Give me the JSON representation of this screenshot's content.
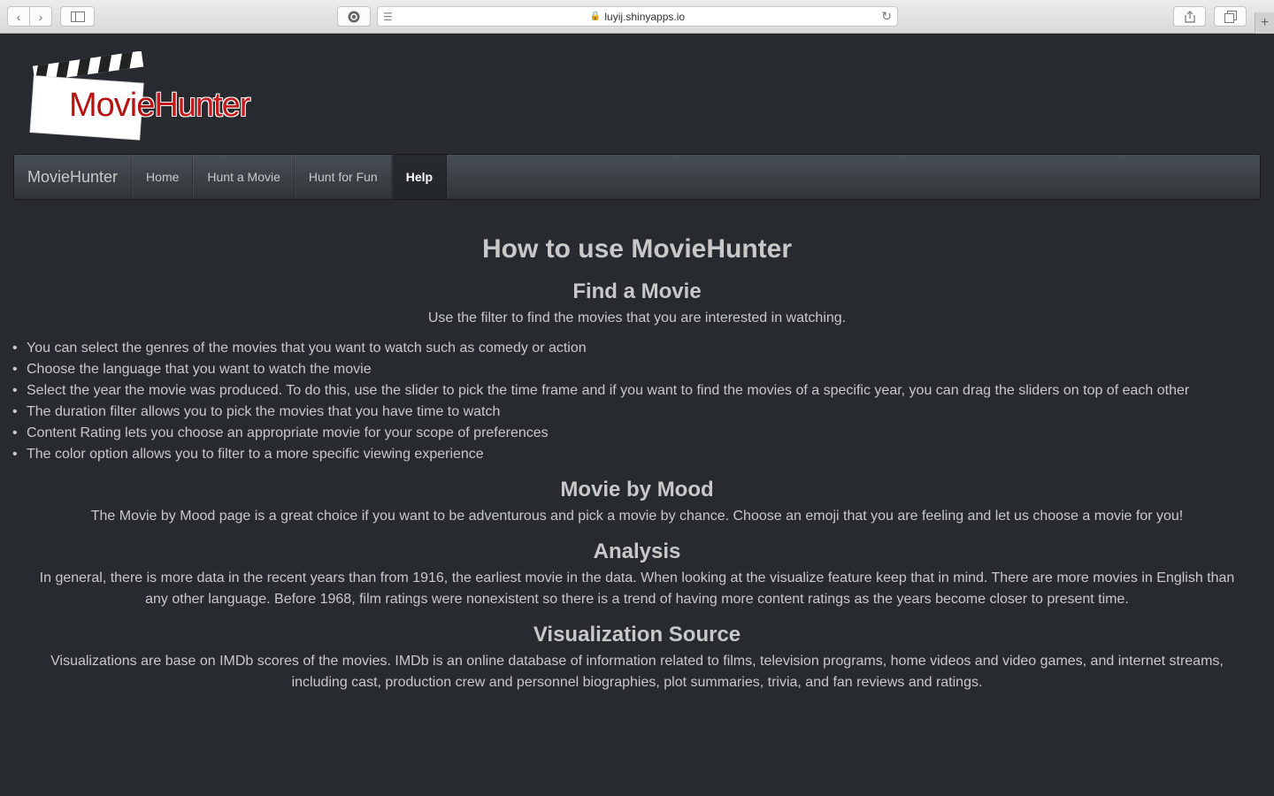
{
  "browser": {
    "url": "luyij.shinyapps.io"
  },
  "logo": {
    "text_movie": "Movie",
    "text_hunter": "Hunter"
  },
  "navbar": {
    "brand": "MovieHunter",
    "items": [
      {
        "label": "Home"
      },
      {
        "label": "Hunt a Movie"
      },
      {
        "label": "Hunt for Fun"
      },
      {
        "label": "Help"
      }
    ],
    "active": "Help"
  },
  "content": {
    "title": "How to use MovieHunter",
    "find": {
      "heading": "Find a Movie",
      "intro": "Use the filter to find the movies that you are interested in watching.",
      "bullets": [
        "You can select the genres of the movies that you want to watch such as comedy or action",
        "Choose the language that you want to watch the movie",
        "Select the year the movie was produced. To do this, use the slider to pick the time frame and if you want to find the movies of a specific year, you can drag the sliders on top of each other",
        "The duration filter allows you to pick the movies that you have time to watch",
        "Content Rating lets you choose an appropriate movie for your scope of preferences",
        "The color option allows you to filter to a more specific viewing experience"
      ]
    },
    "mood": {
      "heading": "Movie by Mood",
      "text": "The Movie by Mood page is a great choice if you want to be adventurous and pick a movie by chance. Choose an emoji that you are feeling and let us choose a movie for you!"
    },
    "analysis": {
      "heading": "Analysis",
      "text": "In general, there is more data in the recent years than from 1916, the earliest movie in the data. When looking at the visualize feature keep that in mind. There are more movies in English than any other language. Before 1968, film ratings were nonexistent so there is a trend of having more content ratings as the years become closer to present time."
    },
    "source": {
      "heading": "Visualization Source",
      "text": "Visualizations are base on IMDb scores of the movies. IMDb is an online database of information related to films, television programs, home videos and video games, and internet streams, including cast, production crew and personnel biographies, plot summaries, trivia, and fan reviews and ratings."
    }
  }
}
